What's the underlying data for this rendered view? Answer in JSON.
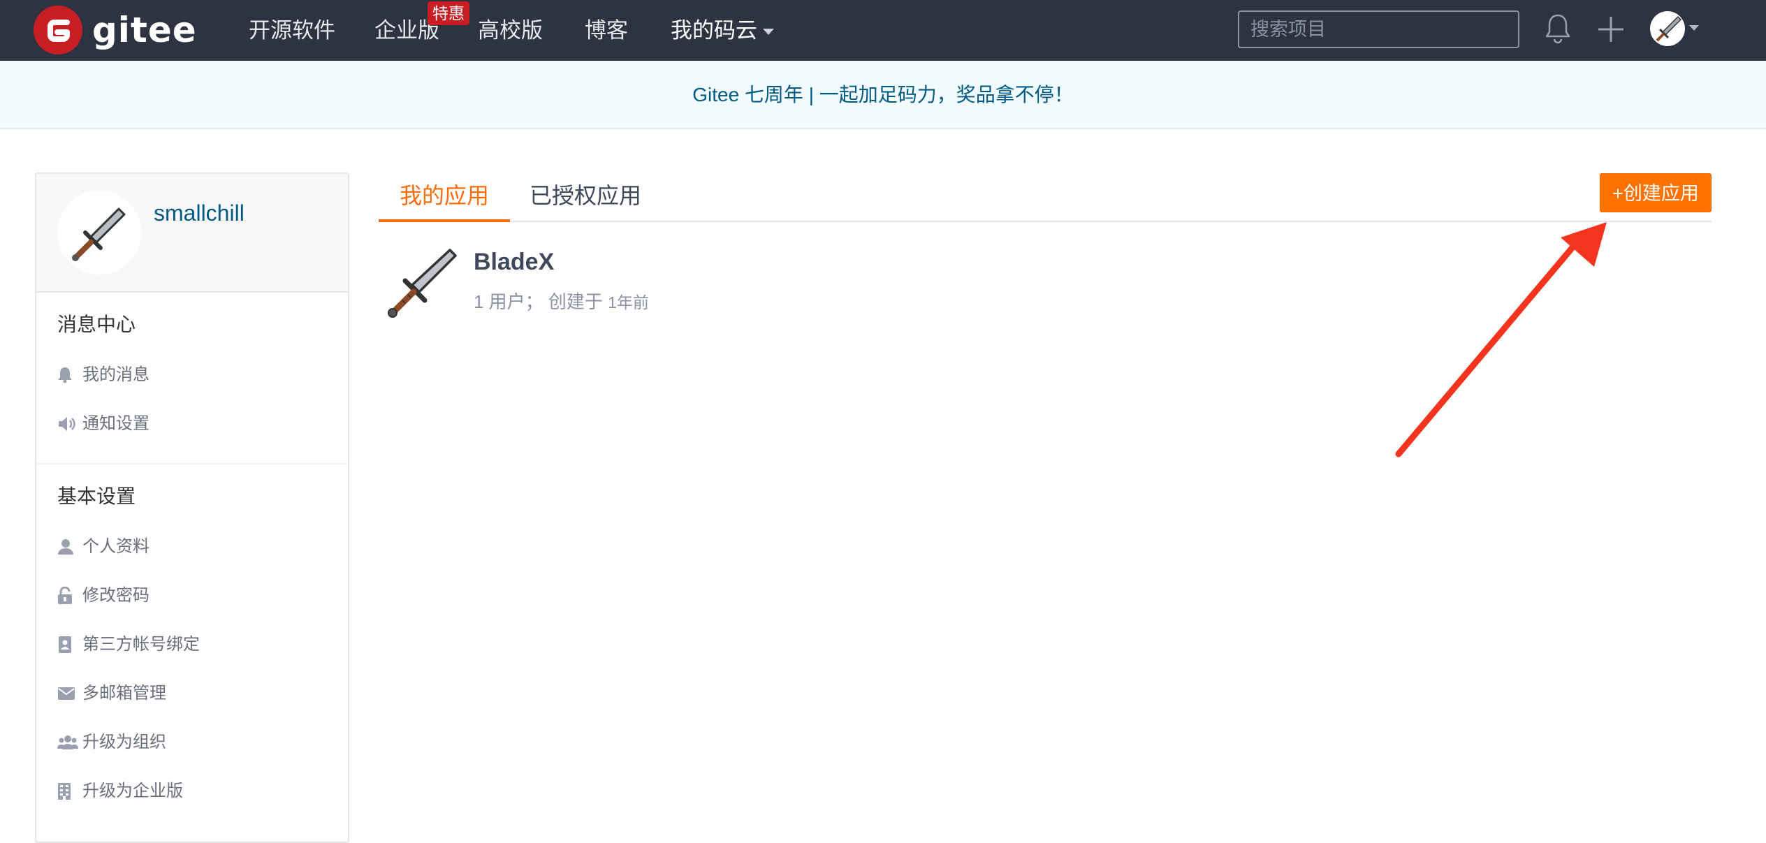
{
  "brand": {
    "name": "gitee"
  },
  "nav": {
    "items": [
      {
        "label": "开源软件"
      },
      {
        "label": "企业版"
      },
      {
        "label": "高校版"
      },
      {
        "label": "博客"
      },
      {
        "label": "我的码云"
      }
    ],
    "enterprise_badge": "特惠",
    "search_placeholder": "搜索项目"
  },
  "banner": {
    "text": "Gitee 七周年 | 一起加足码力，奖品拿不停！"
  },
  "sidebar": {
    "username": "smallchill",
    "sections": [
      {
        "title": "消息中心",
        "items": [
          {
            "label": "我的消息",
            "icon": "bell-icon"
          },
          {
            "label": "通知设置",
            "icon": "speaker-icon"
          }
        ]
      },
      {
        "title": "基本设置",
        "items": [
          {
            "label": "个人资料",
            "icon": "user-icon"
          },
          {
            "label": "修改密码",
            "icon": "unlock-icon"
          },
          {
            "label": "第三方帐号绑定",
            "icon": "contact-book-icon"
          },
          {
            "label": "多邮箱管理",
            "icon": "envelope-icon"
          },
          {
            "label": "升级为组织",
            "icon": "users-icon"
          },
          {
            "label": "升级为企业版",
            "icon": "building-icon"
          }
        ]
      }
    ]
  },
  "main": {
    "tabs": [
      {
        "label": "我的应用",
        "active": true
      },
      {
        "label": "已授权应用",
        "active": false
      }
    ],
    "create_button": "+创建应用",
    "apps": [
      {
        "name": "BladeX",
        "users": "1 用户；",
        "created_prefix": "创建于",
        "created_time": "1年前"
      }
    ]
  },
  "colors": {
    "nav_bg": "#2e3341",
    "brand_red": "#c71d23",
    "accent_orange": "#fe7300",
    "link_blue": "#005980",
    "banner_bg": "#f2fcfe",
    "annotation_arrow": "#f5341f"
  }
}
